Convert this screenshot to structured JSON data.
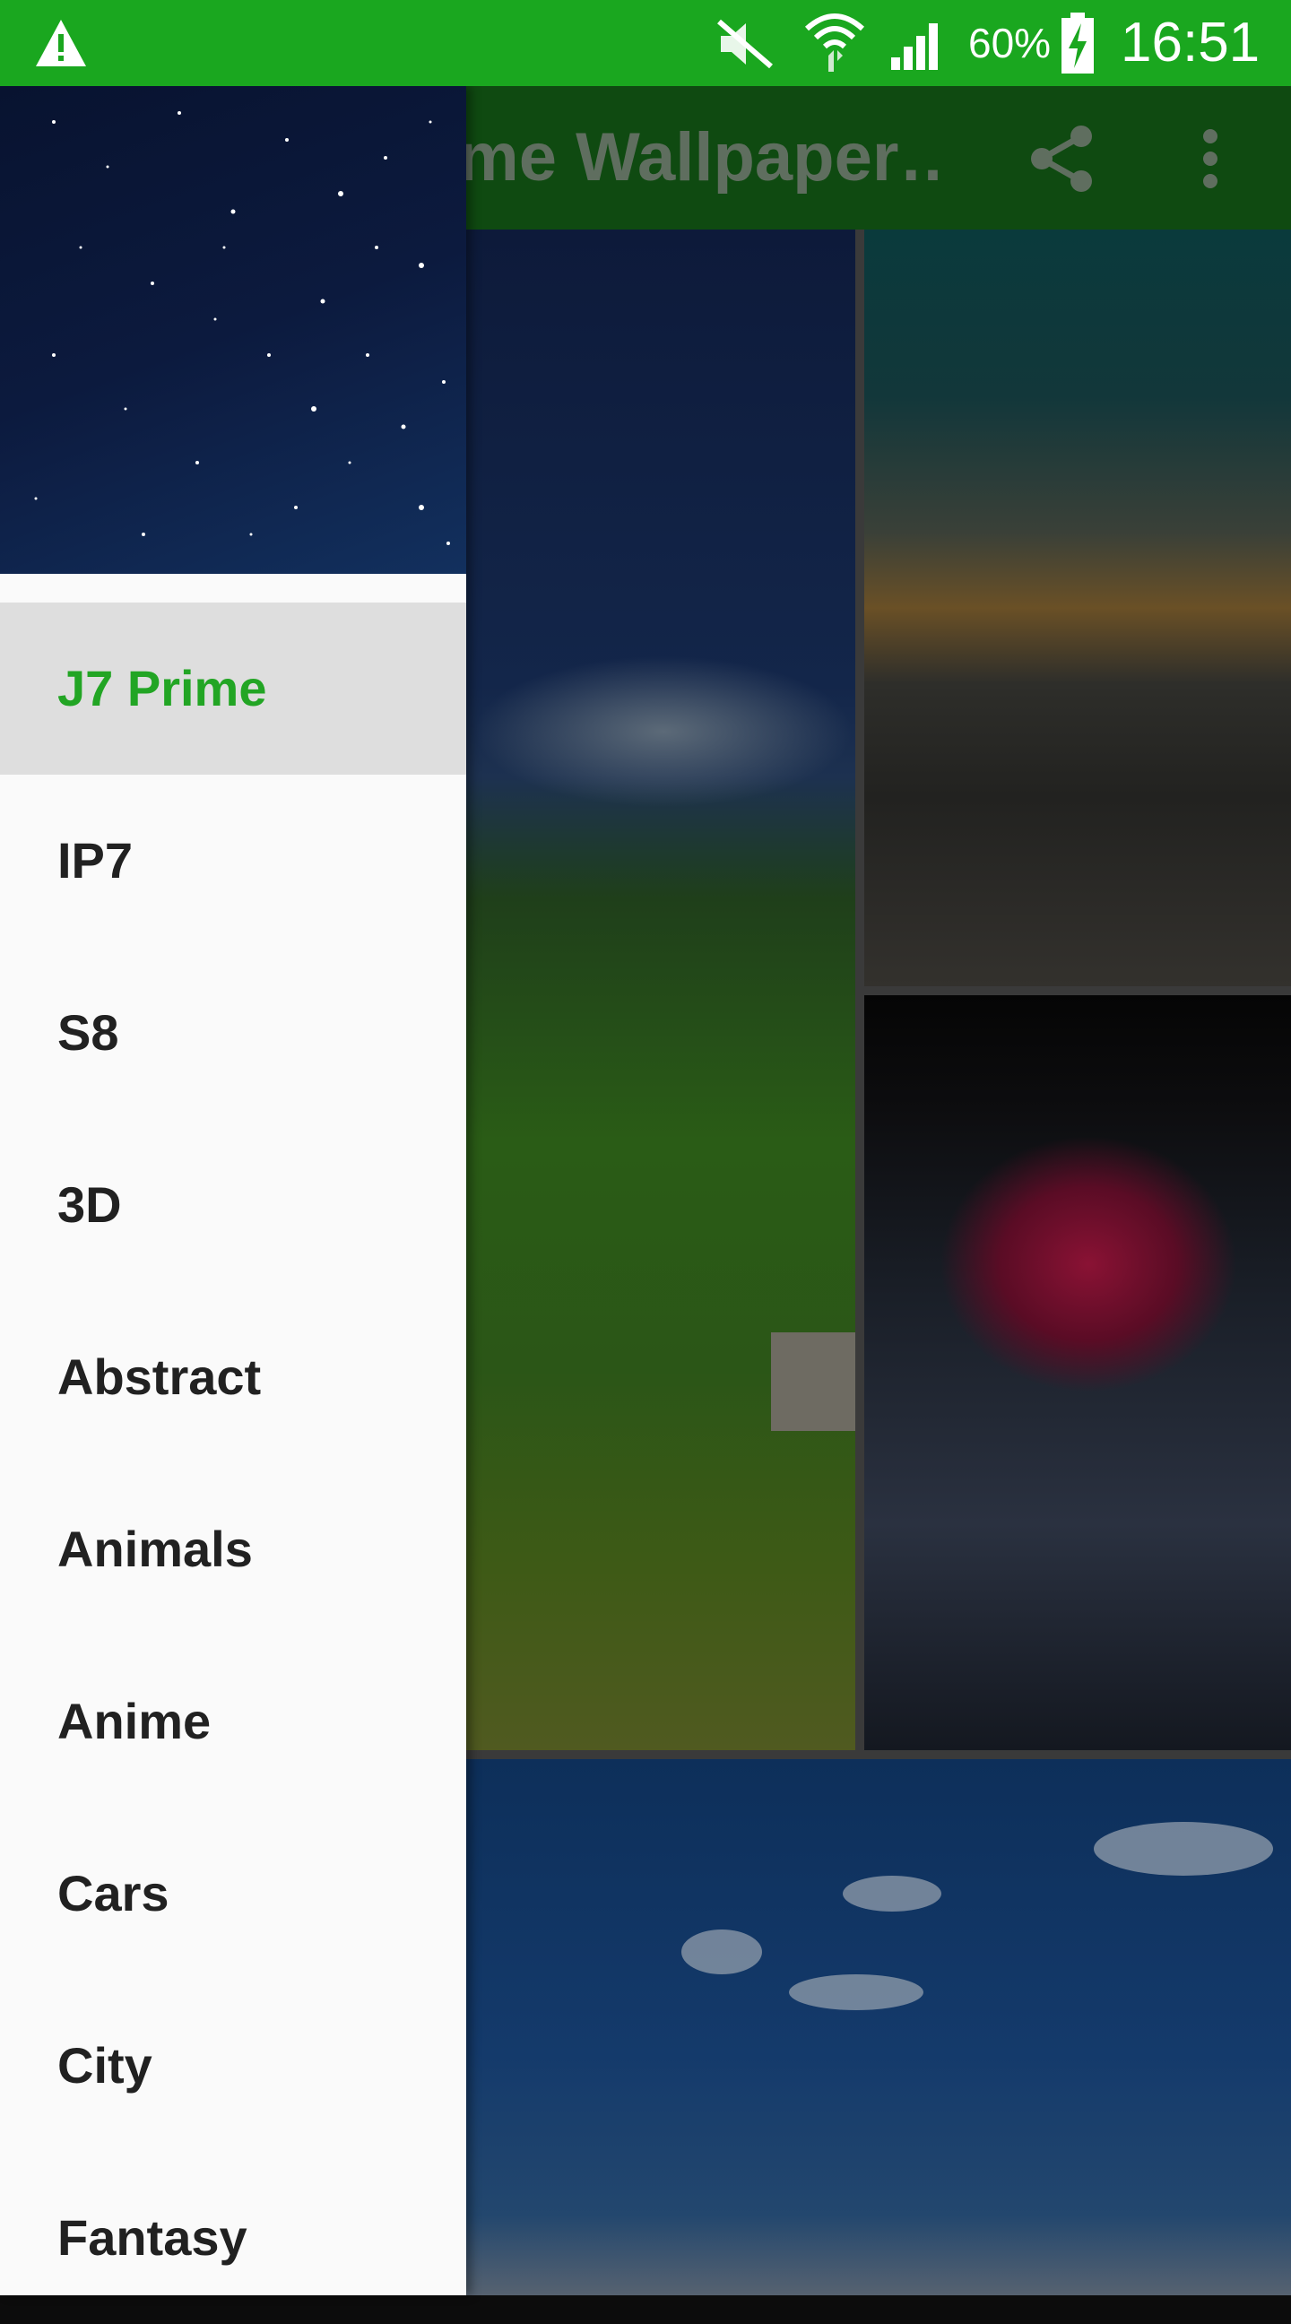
{
  "status_bar": {
    "battery_percent": "60%",
    "time": "16:51",
    "icons": [
      "warning-icon",
      "mute-icon",
      "wifi-icon",
      "signal-icon",
      "battery-charging-icon"
    ]
  },
  "app_bar": {
    "title": "ime Wallpaper…",
    "icons": [
      "share-icon",
      "more-vert-icon"
    ]
  },
  "drawer": {
    "selected_index": 0,
    "items": [
      {
        "label": "J7 Prime"
      },
      {
        "label": "IP7"
      },
      {
        "label": "S8"
      },
      {
        "label": "3D"
      },
      {
        "label": "Abstract"
      },
      {
        "label": "Animals"
      },
      {
        "label": "Anime"
      },
      {
        "label": "Cars"
      },
      {
        "label": "City"
      },
      {
        "label": "Fantasy"
      }
    ]
  },
  "colors": {
    "status_bar": "#1aa71f",
    "accent": "#22a524",
    "selected_item_bg": "#dedede",
    "drawer_bg": "#fafafa"
  }
}
